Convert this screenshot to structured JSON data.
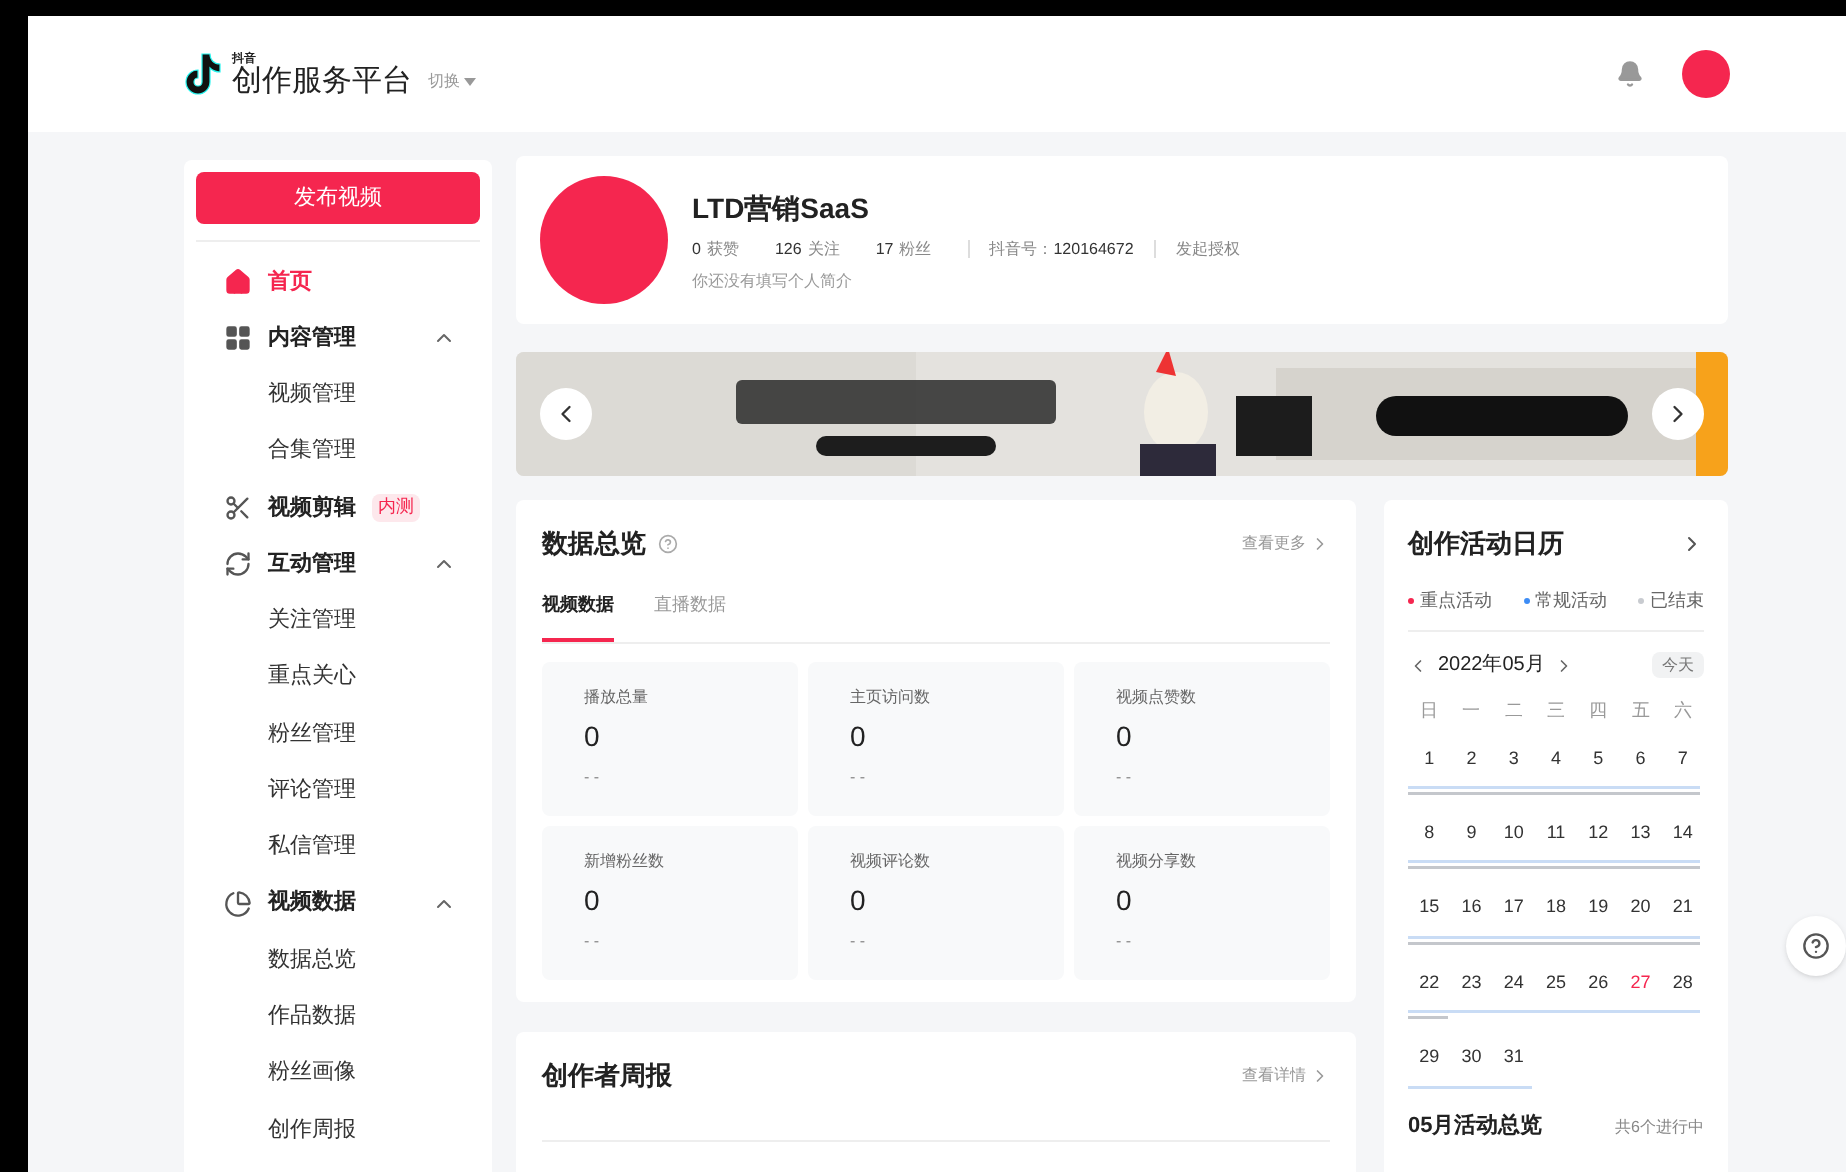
{
  "header": {
    "brand_small": "抖音",
    "brand": "创作服务平台",
    "switch": "切换"
  },
  "sidebar": {
    "publish": "发布视频",
    "items": [
      {
        "kind": "home",
        "label": "首页",
        "selected": true
      },
      {
        "kind": "grid",
        "label": "内容管理",
        "selected": false,
        "expanded": true,
        "children": [
          {
            "label": "视频管理",
            "selected": false
          },
          {
            "label": "合集管理",
            "selected": false
          }
        ]
      },
      {
        "kind": "scissors",
        "label": "视频剪辑",
        "selected": false,
        "badge": "内测"
      },
      {
        "kind": "cycle",
        "label": "互动管理",
        "selected": false,
        "expanded": true,
        "children": [
          {
            "label": "关注管理",
            "selected": false
          },
          {
            "label": "重点关心",
            "selected": false
          },
          {
            "label": "粉丝管理",
            "selected": false
          },
          {
            "label": "评论管理",
            "selected": false
          },
          {
            "label": "私信管理",
            "selected": false
          }
        ]
      },
      {
        "kind": "pie",
        "label": "视频数据",
        "selected": false,
        "expanded": true,
        "children": [
          {
            "label": "数据总览",
            "selected": false
          },
          {
            "label": "作品数据",
            "selected": false
          },
          {
            "label": "粉丝画像",
            "selected": false
          },
          {
            "label": "创作周报",
            "selected": false
          }
        ]
      }
    ]
  },
  "profile": {
    "name": "LTD营销SaaS",
    "stats": [
      {
        "value": "0",
        "label": "获赞"
      },
      {
        "value": "126",
        "label": "关注"
      },
      {
        "value": "17",
        "label": "粉丝"
      }
    ],
    "id_label": "抖音号：",
    "id": "120164672",
    "auth": "发起授权",
    "bio": "你还没有填写个人简介"
  },
  "overview": {
    "title": "数据总览",
    "more": "查看更多",
    "tabs": [
      {
        "label": "视频数据",
        "selected": true
      },
      {
        "label": "直播数据",
        "selected": false
      }
    ],
    "stats": [
      {
        "label": "播放总量",
        "value": "0",
        "change": "- -"
      },
      {
        "label": "主页访问数",
        "value": "0",
        "change": "- -"
      },
      {
        "label": "视频点赞数",
        "value": "0",
        "change": "- -"
      },
      {
        "label": "新增粉丝数",
        "value": "0",
        "change": "- -"
      },
      {
        "label": "视频评论数",
        "value": "0",
        "change": "- -"
      },
      {
        "label": "视频分享数",
        "value": "0",
        "change": "- -"
      }
    ]
  },
  "weekly": {
    "title": "创作者周报",
    "more": "查看详情"
  },
  "calendar": {
    "title": "创作活动日历",
    "legend": [
      {
        "label": "重点活动",
        "color": "#f5264f"
      },
      {
        "label": "常规活动",
        "color": "#3d8cf5"
      },
      {
        "label": "已结束",
        "color": "#c8cbd0"
      }
    ],
    "month": "2022年05月",
    "today_button": "今天",
    "weekdays": [
      "日",
      "一",
      "二",
      "三",
      "四",
      "五",
      "六"
    ],
    "weeks": [
      [
        {
          "day": "1",
          "today": false
        },
        {
          "day": "2",
          "today": false
        },
        {
          "day": "3",
          "today": false
        },
        {
          "day": "4",
          "today": false
        },
        {
          "day": "5",
          "today": false
        },
        {
          "day": "6",
          "today": false
        },
        {
          "day": "7",
          "today": false
        }
      ],
      [
        {
          "day": "8",
          "today": false
        },
        {
          "day": "9",
          "today": false
        },
        {
          "day": "10",
          "today": false
        },
        {
          "day": "11",
          "today": false
        },
        {
          "day": "12",
          "today": false
        },
        {
          "day": "13",
          "today": false
        },
        {
          "day": "14",
          "today": false
        }
      ],
      [
        {
          "day": "15",
          "today": false
        },
        {
          "day": "16",
          "today": false
        },
        {
          "day": "17",
          "today": false
        },
        {
          "day": "18",
          "today": false
        },
        {
          "day": "19",
          "today": false
        },
        {
          "day": "20",
          "today": false
        },
        {
          "day": "21",
          "today": false
        }
      ],
      [
        {
          "day": "22",
          "today": false
        },
        {
          "day": "23",
          "today": false
        },
        {
          "day": "24",
          "today": false
        },
        {
          "day": "25",
          "today": false
        },
        {
          "day": "26",
          "today": false
        },
        {
          "day": "27",
          "today": true
        },
        {
          "day": "28",
          "today": false
        }
      ],
      [
        {
          "day": "29",
          "today": false
        },
        {
          "day": "30",
          "today": false
        },
        {
          "day": "31",
          "today": false
        }
      ]
    ],
    "summary_title": "05月活动总览",
    "summary_count": "共6个进行中"
  }
}
